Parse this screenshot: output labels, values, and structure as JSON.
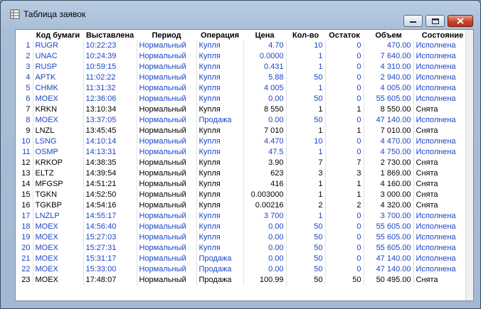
{
  "window": {
    "title": "Таблица заявок"
  },
  "columns": [
    "",
    "Код бумаги",
    "Выставлена",
    "Период",
    "Операция",
    "Цена",
    "Кол-во",
    "Остаток",
    "Объем",
    "Состояние"
  ],
  "rows": [
    {
      "n": "1",
      "code": "RUGR",
      "time": "10:22:23",
      "period": "Нормальный",
      "op": "Купля",
      "price": "4.70",
      "qty": "10",
      "rest": "0",
      "volume": "470.00",
      "state": "Исполнена",
      "color": "blue"
    },
    {
      "n": "2",
      "code": "UNAC",
      "time": "10:24:39",
      "period": "Нормальный",
      "op": "Купля",
      "price": "0.0000",
      "qty": "1",
      "rest": "0",
      "volume": "7 640.00",
      "state": "Исполнена",
      "color": "blue"
    },
    {
      "n": "3",
      "code": "RUSP",
      "time": "10:59:15",
      "period": "Нормальный",
      "op": "Купля",
      "price": "0.431",
      "qty": "1",
      "rest": "0",
      "volume": "4 310.00",
      "state": "Исполнена",
      "color": "blue"
    },
    {
      "n": "4",
      "code": "APTK",
      "time": "11:02:22",
      "period": "Нормальный",
      "op": "Купля",
      "price": "5.88",
      "qty": "50",
      "rest": "0",
      "volume": "2 940.00",
      "state": "Исполнена",
      "color": "blue"
    },
    {
      "n": "5",
      "code": "CHMK",
      "time": "11:31:32",
      "period": "Нормальный",
      "op": "Купля",
      "price": "4 005",
      "qty": "1",
      "rest": "0",
      "volume": "4 005.00",
      "state": "Исполнена",
      "color": "blue"
    },
    {
      "n": "6",
      "code": "MOEX",
      "time": "12:36:06",
      "period": "Нормальный",
      "op": "Купля",
      "price": "0.00",
      "qty": "50",
      "rest": "0",
      "volume": "55 605.00",
      "state": "Исполнена",
      "color": "blue"
    },
    {
      "n": "7",
      "code": "KRKN",
      "time": "13:10:34",
      "period": "Нормальный",
      "op": "Купля",
      "price": "8 550",
      "qty": "1",
      "rest": "1",
      "volume": "8 550.00",
      "state": "Снята",
      "color": "black"
    },
    {
      "n": "8",
      "code": "MOEX",
      "time": "13:37:05",
      "period": "Нормальный",
      "op": "Продажа",
      "price": "0.00",
      "qty": "50",
      "rest": "0",
      "volume": "47 140.00",
      "state": "Исполнена",
      "color": "blue"
    },
    {
      "n": "9",
      "code": "LNZL",
      "time": "13:45:45",
      "period": "Нормальный",
      "op": "Купля",
      "price": "7 010",
      "qty": "1",
      "rest": "1",
      "volume": "7 010.00",
      "state": "Снята",
      "color": "black"
    },
    {
      "n": "10",
      "code": "LSNG",
      "time": "14:10:14",
      "period": "Нормальный",
      "op": "Купля",
      "price": "4.470",
      "qty": "10",
      "rest": "0",
      "volume": "4 470.00",
      "state": "Исполнена",
      "color": "blue"
    },
    {
      "n": "11",
      "code": "OSMP",
      "time": "14:13:31",
      "period": "Нормальный",
      "op": "Купля",
      "price": "47.5",
      "qty": "1",
      "rest": "0",
      "volume": "4 750.00",
      "state": "Исполнена",
      "color": "blue"
    },
    {
      "n": "12",
      "code": "KRKOP",
      "time": "14:38:35",
      "period": "Нормальный",
      "op": "Купля",
      "price": "3.90",
      "qty": "7",
      "rest": "7",
      "volume": "2 730.00",
      "state": "Снята",
      "color": "black"
    },
    {
      "n": "13",
      "code": "ELTZ",
      "time": "14:39:54",
      "period": "Нормальный",
      "op": "Купля",
      "price": "623",
      "qty": "3",
      "rest": "3",
      "volume": "1 869.00",
      "state": "Снята",
      "color": "black"
    },
    {
      "n": "14",
      "code": "MFGSP",
      "time": "14:51:21",
      "period": "Нормальный",
      "op": "Купля",
      "price": "416",
      "qty": "1",
      "rest": "1",
      "volume": "4 160.00",
      "state": "Снята",
      "color": "black"
    },
    {
      "n": "15",
      "code": "TGKN",
      "time": "14:52:50",
      "period": "Нормальный",
      "op": "Купля",
      "price": "0.003000",
      "qty": "1",
      "rest": "1",
      "volume": "3 000.00",
      "state": "Снята",
      "color": "black"
    },
    {
      "n": "16",
      "code": "TGKBP",
      "time": "14:54:16",
      "period": "Нормальный",
      "op": "Купля",
      "price": "0.00216",
      "qty": "2",
      "rest": "2",
      "volume": "4 320.00",
      "state": "Снята",
      "color": "black"
    },
    {
      "n": "17",
      "code": "LNZLP",
      "time": "14:55:17",
      "period": "Нормальный",
      "op": "Купля",
      "price": "3 700",
      "qty": "1",
      "rest": "0",
      "volume": "3 700.00",
      "state": "Исполнена",
      "color": "blue"
    },
    {
      "n": "18",
      "code": "MOEX",
      "time": "14:56:40",
      "period": "Нормальный",
      "op": "Купля",
      "price": "0.00",
      "qty": "50",
      "rest": "0",
      "volume": "55 605.00",
      "state": "Исполнена",
      "color": "blue"
    },
    {
      "n": "19",
      "code": "MOEX",
      "time": "15:27:03",
      "period": "Нормальный",
      "op": "Купля",
      "price": "0.00",
      "qty": "50",
      "rest": "0",
      "volume": "55 605.00",
      "state": "Исполнена",
      "color": "blue"
    },
    {
      "n": "20",
      "code": "MOEX",
      "time": "15:27:31",
      "period": "Нормальный",
      "op": "Купля",
      "price": "0.00",
      "qty": "50",
      "rest": "0",
      "volume": "55 605.00",
      "state": "Исполнена",
      "color": "blue"
    },
    {
      "n": "21",
      "code": "MOEX",
      "time": "15:31:17",
      "period": "Нормальный",
      "op": "Продажа",
      "price": "0.00",
      "qty": "50",
      "rest": "0",
      "volume": "47 140.00",
      "state": "Исполнена",
      "color": "blue"
    },
    {
      "n": "22",
      "code": "MOEX",
      "time": "15:33:00",
      "period": "Нормальный",
      "op": "Продажа",
      "price": "0.00",
      "qty": "50",
      "rest": "0",
      "volume": "47 140.00",
      "state": "Исполнена",
      "color": "blue"
    },
    {
      "n": "23",
      "code": "MOEX",
      "time": "17:48:07",
      "period": "Нормальный",
      "op": "Продажа",
      "price": "100.99",
      "qty": "50",
      "rest": "50",
      "volume": "50 495.00",
      "state": "Снята",
      "color": "black"
    }
  ],
  "colors": {
    "executed": "#1a45c8",
    "cancelled": "#000000"
  }
}
